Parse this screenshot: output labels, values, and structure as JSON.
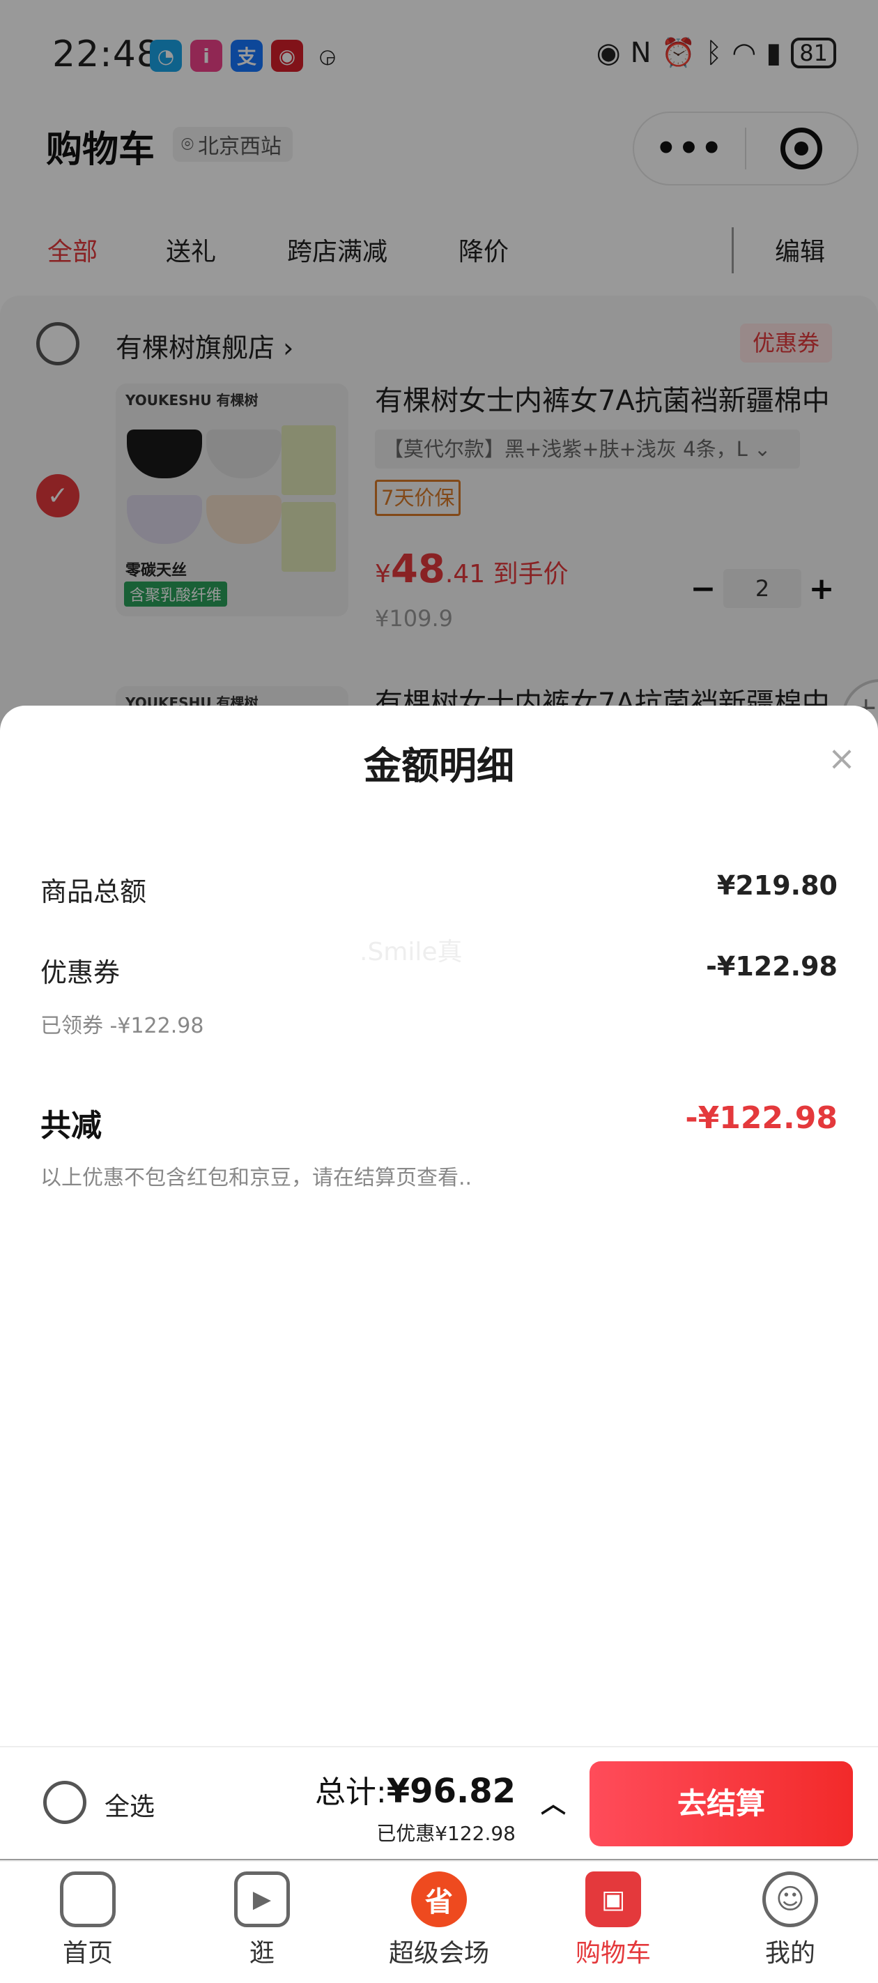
{
  "status_bar": {
    "time": "22:48",
    "battery": "81"
  },
  "header": {
    "title": "购物车",
    "location": "北京西站",
    "capsule_more": "•••"
  },
  "tabs": [
    {
      "label": "全部",
      "active": true
    },
    {
      "label": "送礼",
      "active": false
    },
    {
      "label": "跨店满减",
      "active": false
    },
    {
      "label": "降价",
      "active": false
    }
  ],
  "edit_label": "编辑",
  "shop": {
    "name": "有棵树旗舰店",
    "coupon_tag": "优惠券",
    "product1": {
      "brand": "YOUKESHU 有棵树",
      "img_caption1": "零碳天丝",
      "img_caption2": "含聚乳酸纤维",
      "title": "有棵树女士内裤女7A抗菌裆新疆棉中",
      "variant": "【莫代尔款】黑+浅紫+肤+浅灰 4条，L",
      "guarantee": "7天价保",
      "currency": "¥",
      "price_int": "48",
      "price_dec": ".41",
      "price_suffix": "到手价",
      "original_price": "¥109.9",
      "quantity": "2"
    },
    "product2": {
      "brand": "YOUKESHU 有棵树",
      "title": "有棵树女士内裤女7A抗菌裆新疆棉中"
    }
  },
  "sheet": {
    "title": "金额明细",
    "close": "×",
    "goods_total_label": "商品总额",
    "goods_total_value": "¥219.80",
    "coupon_label": "优惠券",
    "coupon_value": "-¥122.98",
    "coupon_note": "已领券 -¥122.98",
    "total_discount_label": "共减",
    "total_discount_value": "-¥122.98",
    "disclaimer": "以上优惠不包含红包和京豆，请在结算页查看..",
    "watermark": ".Smile真"
  },
  "checkout": {
    "select_all": "全选",
    "total_prefix": "总计:",
    "total_value": "¥96.82",
    "saved": "已优惠¥122.98",
    "button": "去结算"
  },
  "nav": [
    {
      "label": "首页",
      "icon": "home-icon",
      "active": false
    },
    {
      "label": "逛",
      "icon": "video-play-icon",
      "active": false
    },
    {
      "label": "超级会场",
      "icon": "super-venue-icon",
      "active": false
    },
    {
      "label": "购物车",
      "icon": "cart-icon",
      "active": true
    },
    {
      "label": "我的",
      "icon": "smiley-profile-icon",
      "active": false
    }
  ],
  "colors": {
    "accent": "#e4393c",
    "checkout_gradient_start": "#ff4c5a",
    "checkout_gradient_end": "#f22a2a"
  }
}
